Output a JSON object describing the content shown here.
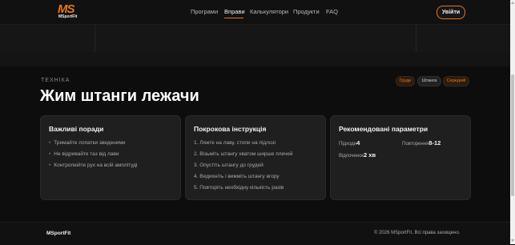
{
  "header": {
    "logo_text": "MS",
    "logo_sub": "MSportFit",
    "nav": [
      {
        "label": "Програми"
      },
      {
        "label": "Вправи"
      },
      {
        "label": "Калькулятори"
      },
      {
        "label": "Продукти"
      },
      {
        "label": "FAQ"
      }
    ],
    "active_nav": "Вправи",
    "login_label": "Увійти"
  },
  "exercise": {
    "eyebrow": "ТЕХНІКА",
    "title": "Жим штанги лежачи",
    "tags": [
      "Груди",
      "Штанга",
      "Середній"
    ]
  },
  "cards": {
    "tips": {
      "title": "Важливі поради",
      "items": [
        "Тримайте лопатки зведеними",
        "Не відривайте таз від лави",
        "Контролюйте рух на всій амплітуді"
      ]
    },
    "steps": {
      "title": "Покрокова інструкція",
      "items": [
        "1. Ляжте на лаву, стопи на підлозі",
        "2. Візьміть штангу хватом ширше плечей",
        "3. Опустіть штангу до грудей",
        "4. Видихніть і вижміть штангу вгору",
        "5. Повторіть необхідну кількість разів"
      ]
    },
    "params": {
      "title": "Рекомендовані параметри",
      "sets_label": "Підходи",
      "sets_value": "4",
      "reps_label": "Повторення",
      "reps_value": "8-12",
      "rest_label": "Відпочинок",
      "rest_value": "2 хв"
    }
  },
  "footer": {
    "brand": "MSportFit",
    "copyright": "© 2026 MSportFit. Всі права захищено."
  },
  "colors": {
    "accent": "#e5761c",
    "background": "#0d0d0d",
    "card": "#1f1f1f"
  }
}
